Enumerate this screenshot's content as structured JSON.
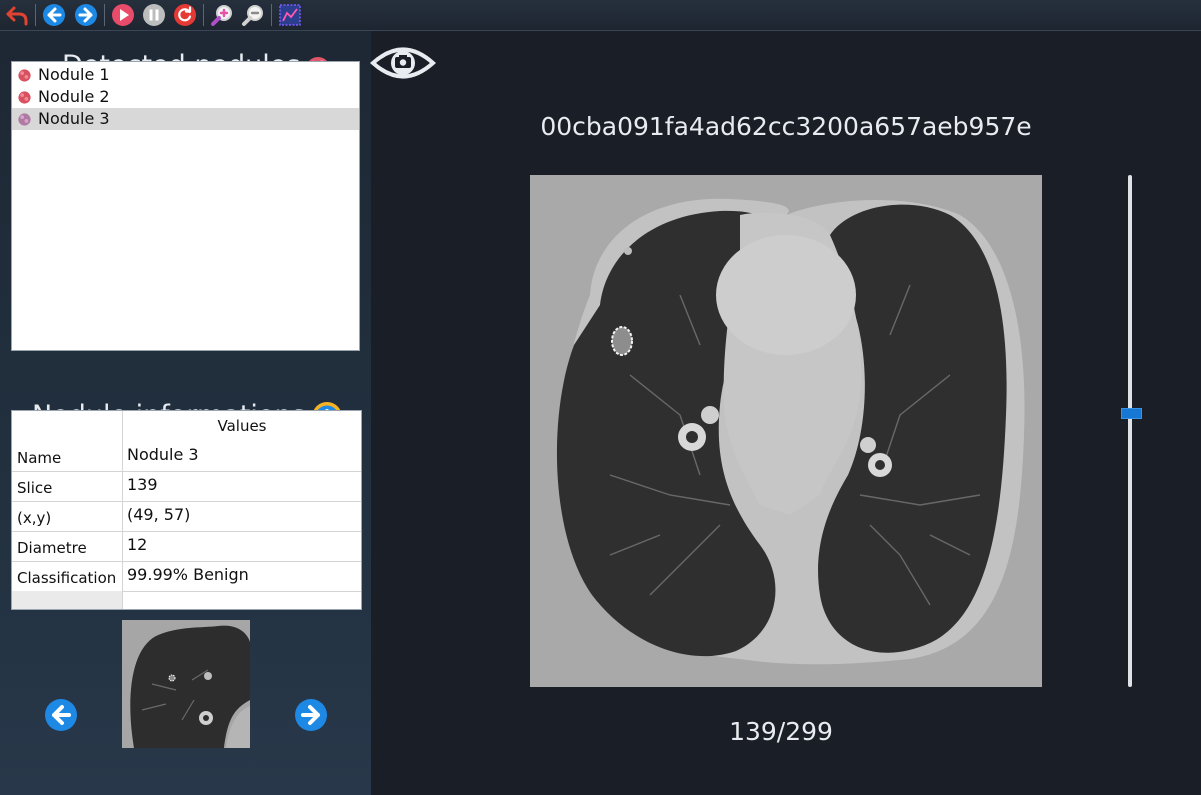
{
  "toolbar": {
    "buttons": [
      {
        "name": "undo-icon",
        "color": "#e0432f"
      },
      {
        "name": "back-arrow-icon",
        "color": "#1e88e5"
      },
      {
        "name": "forward-arrow-icon",
        "color": "#1e88e5"
      },
      {
        "name": "play-icon",
        "color": "#e94b6a"
      },
      {
        "name": "pause-icon",
        "color": "#bdbdbd"
      },
      {
        "name": "reset-icon",
        "color": "#e53935"
      },
      {
        "name": "zoom-in-icon",
        "color": "#e84fa8"
      },
      {
        "name": "zoom-out-icon",
        "color": "#d0d0d0"
      },
      {
        "name": "analysis-icon",
        "color": "#7b5cff"
      }
    ]
  },
  "left": {
    "detected_title": "Detected nodules",
    "nodules": [
      {
        "label": "Nodule 1",
        "selected": false,
        "icon": "nodule-icon"
      },
      {
        "label": "Nodule 2",
        "selected": false,
        "icon": "nodule-icon"
      },
      {
        "label": "Nodule 3",
        "selected": true,
        "icon": "nodule-icon"
      }
    ],
    "info_title": "Nodule informations",
    "info_icon": "info-icon",
    "table": {
      "header": "Values",
      "rows": [
        {
          "key": "Name",
          "value": "Nodule 3"
        },
        {
          "key": "Slice",
          "value": "139"
        },
        {
          "key": "(x,y)",
          "value": "(49, 57)"
        },
        {
          "key": "Diametre",
          "value": "12"
        },
        {
          "key": "Classification",
          "value": "99.99% Benign"
        },
        {
          "key": "",
          "value": ""
        }
      ]
    },
    "prev_icon": "prev-nodule-icon",
    "next_icon": "next-nodule-icon"
  },
  "viewer": {
    "eye_icon": "camera-eye-icon",
    "case_id": "00cba091fa4ad62cc3200a657aeb957e",
    "slice_label": "139/299",
    "slice_index": 139,
    "slice_total": 299
  },
  "colors": {
    "accent": "#1778d4",
    "panel": "#22303f",
    "background": "#1a1f27"
  }
}
